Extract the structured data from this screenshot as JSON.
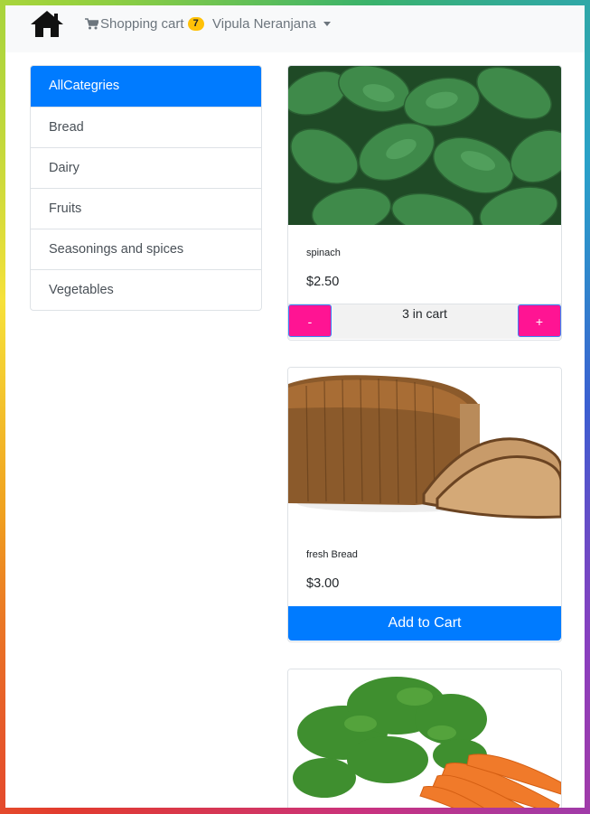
{
  "navbar": {
    "home_icon": "home-icon",
    "cart_icon": "shopping-cart-icon",
    "cart_label": "Shopping cart",
    "cart_count": "7",
    "user_name": "Vipula Neranjana",
    "user_dropdown_icon": "caret-down-icon"
  },
  "sidebar": {
    "items": [
      {
        "label": "AllCategries",
        "active": true
      },
      {
        "label": "Bread"
      },
      {
        "label": "Dairy"
      },
      {
        "label": "Fruits"
      },
      {
        "label": "Seasonings and spices"
      },
      {
        "label": "Vegetables"
      }
    ]
  },
  "products": [
    {
      "title": "spinach",
      "price": "$2.50",
      "image": "spinach-image",
      "qty_text": "3 in cart",
      "minus_label": "-",
      "plus_label": "+"
    },
    {
      "title": "fresh Bread",
      "price": "$3.00",
      "image": "bread-image",
      "button_label": "Add to Cart"
    },
    {
      "image": "carrots-image"
    }
  ],
  "colors": {
    "primary": "#007bff",
    "qty_button": "#ff1493",
    "badge": "#ffc107",
    "navbar_bg": "#f8f9fa"
  }
}
